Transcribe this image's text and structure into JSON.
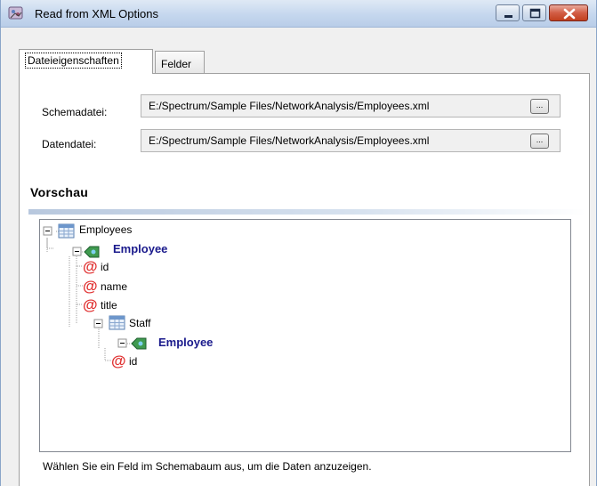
{
  "window": {
    "title": "Read from XML Options"
  },
  "tabs": [
    {
      "label": "Dateieigenschaften",
      "active": true
    },
    {
      "label": "Felder",
      "active": false
    }
  ],
  "fields": {
    "schema_label": "Schemadatei:",
    "schema_value": "E:/Spectrum/Sample Files/NetworkAnalysis/Employees.xml",
    "data_label": "Datendatei:",
    "data_value": "E:/Spectrum/Sample Files/NetworkAnalysis/Employees.xml",
    "browse_label": "..."
  },
  "preview": {
    "title": "Vorschau",
    "tree": [
      {
        "label": "Employees",
        "kind": "table",
        "depth": 0
      },
      {
        "label": "Employee",
        "kind": "element",
        "depth": 1
      },
      {
        "label": "id",
        "kind": "attribute",
        "depth": 2
      },
      {
        "label": "name",
        "kind": "attribute",
        "depth": 2
      },
      {
        "label": "title",
        "kind": "attribute",
        "depth": 2
      },
      {
        "label": "Staff",
        "kind": "table",
        "depth": 2
      },
      {
        "label": "Employee",
        "kind": "element",
        "depth": 3
      },
      {
        "label": "id",
        "kind": "attribute",
        "depth": 4
      }
    ]
  },
  "status": {
    "text": "Wählen Sie ein Feld im Schemabaum aus, um die Daten anzuzeigen."
  },
  "colors": {
    "element_text": "#1a1a8c",
    "attribute_icon": "#e03030"
  }
}
